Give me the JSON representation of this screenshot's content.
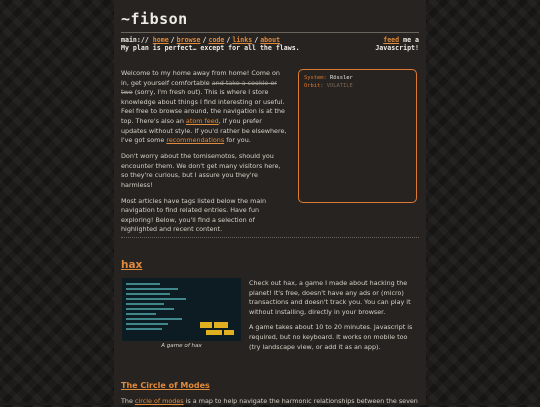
{
  "site": {
    "title": "~fibson"
  },
  "nav": {
    "prefix": "main://",
    "links": [
      "home",
      "browse",
      "code",
      "links",
      "about"
    ],
    "feed_link": "feed",
    "feed_suffix": "me a",
    "tagline": "My plan is perfect… except for all the flaws.",
    "javascript_note": "Javascript!"
  },
  "intro": {
    "p1_a": "Welcome to my home away from home! Come on in, get yourself comfortable ",
    "p1_strike": "and take a cookie or two",
    "p1_b": " (sorry, I'm fresh out). This is where I store knowledge about things I find interesting or useful. Feel free to browse around, the navigation is at the top. There's also an ",
    "p1_link1": "atom feed",
    "p1_c": ", if you prefer updates without style. If you'd rather be elsewhere, I've got some ",
    "p1_link2": "recommendations",
    "p1_d": " for you.",
    "p2": "Don't worry about the tomisemotos, should you encounter them. We don't get many visitors here, so they're curious, but I assure you they're harmless!",
    "p3": "Most articles have tags listed below the main navigation to find related entries. Have fun exploring! Below, you'll find a selection of highlighted and recent content."
  },
  "system_panel": {
    "system_key": "System:",
    "system_value": "Rössler",
    "orbit_key": "Orbit:",
    "orbit_value": "VOLATILE"
  },
  "hax": {
    "title": "hax",
    "caption": "A game of hax",
    "p1_a": "Check out ",
    "p1_link": "hax",
    "p1_b": ", a game I made about hacking the planet! It's free, doesn't have any ads or (micro) transactions and doesn't track you. You can play it without installing, directly in your browser.",
    "p2": "A game takes about 10 to 20 minutes. Javascript is required, but no keyboard. It works on mobile too (try landscape view, or add it as an app)."
  },
  "circle": {
    "title": "The Circle of Modes",
    "p_a": "The ",
    "p_link": "circle of modes",
    "p_b": " is a map to help navigate the harmonic relationships between the seven"
  },
  "colors": {
    "accent": "#e08a3c",
    "background": "#262320"
  }
}
